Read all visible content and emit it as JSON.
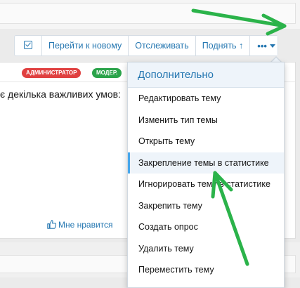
{
  "toolbar": {
    "go_to_new": "Перейти к новому",
    "watch": "Отслеживать",
    "bump": "Поднять",
    "bump_icon": "arrow-up-icon",
    "more_dots": "•••"
  },
  "post": {
    "badges": [
      "АДМИНИСТРАТОР",
      "МОДЕР."
    ],
    "text": "є декілька важливих умов:",
    "like": "Мне нравится"
  },
  "menu": {
    "header": "Дополнительно",
    "items": [
      "Редактировать тему",
      "Изменить тип темы",
      "Открыть тему",
      "Закрепление темы в статистике",
      "Игнорировать тему в статистике",
      "Закрепить тему",
      "Создать опрос",
      "Удалить тему",
      "Переместить тему"
    ]
  },
  "colors": {
    "link": "#2577b1",
    "admin_badge": "#e04040",
    "mod_badge": "#2aa34a",
    "annotation": "#2bb34a",
    "highlight_bar": "#47a7eb"
  }
}
